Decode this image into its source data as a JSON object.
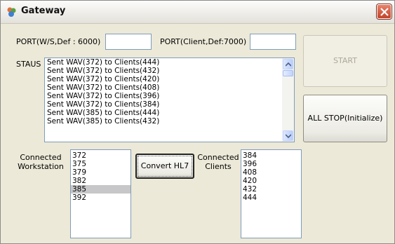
{
  "window": {
    "title": "Gateway"
  },
  "ports": {
    "ws_label": "PORT(W/S,Def : 6000)",
    "ws_value": "",
    "client_label": "PORT(Client,Def:7000)",
    "client_value": ""
  },
  "status": {
    "label": "STAUS",
    "lines": [
      "Sent WAV(372) to Clients(444)",
      "Sent WAV(372) to Clients(432)",
      "Sent WAV(372) to Clients(420)",
      "Sent WAV(372) to Clients(408)",
      "Sent WAV(372) to Clients(396)",
      "Sent WAV(372) to Clients(384)",
      "Sent WAV(385) to Clients(444)",
      "Sent WAV(385) to Clients(432)"
    ]
  },
  "buttons": {
    "start": "START",
    "all_stop": "ALL STOP(Initialize)",
    "convert": "Convert HL7"
  },
  "workstations": {
    "label_line1": "Connected",
    "label_line2": "Workstation",
    "items": [
      "372",
      "375",
      "379",
      "382",
      "385",
      "392"
    ],
    "selected": "385"
  },
  "clients": {
    "label_line1": "Connected",
    "label_line2": "Clients",
    "items": [
      "384",
      "396",
      "408",
      "420",
      "432",
      "444"
    ]
  },
  "colors": {
    "close": "#d2553b",
    "face": "#ece9d8",
    "selection": "#c7c6c9"
  }
}
